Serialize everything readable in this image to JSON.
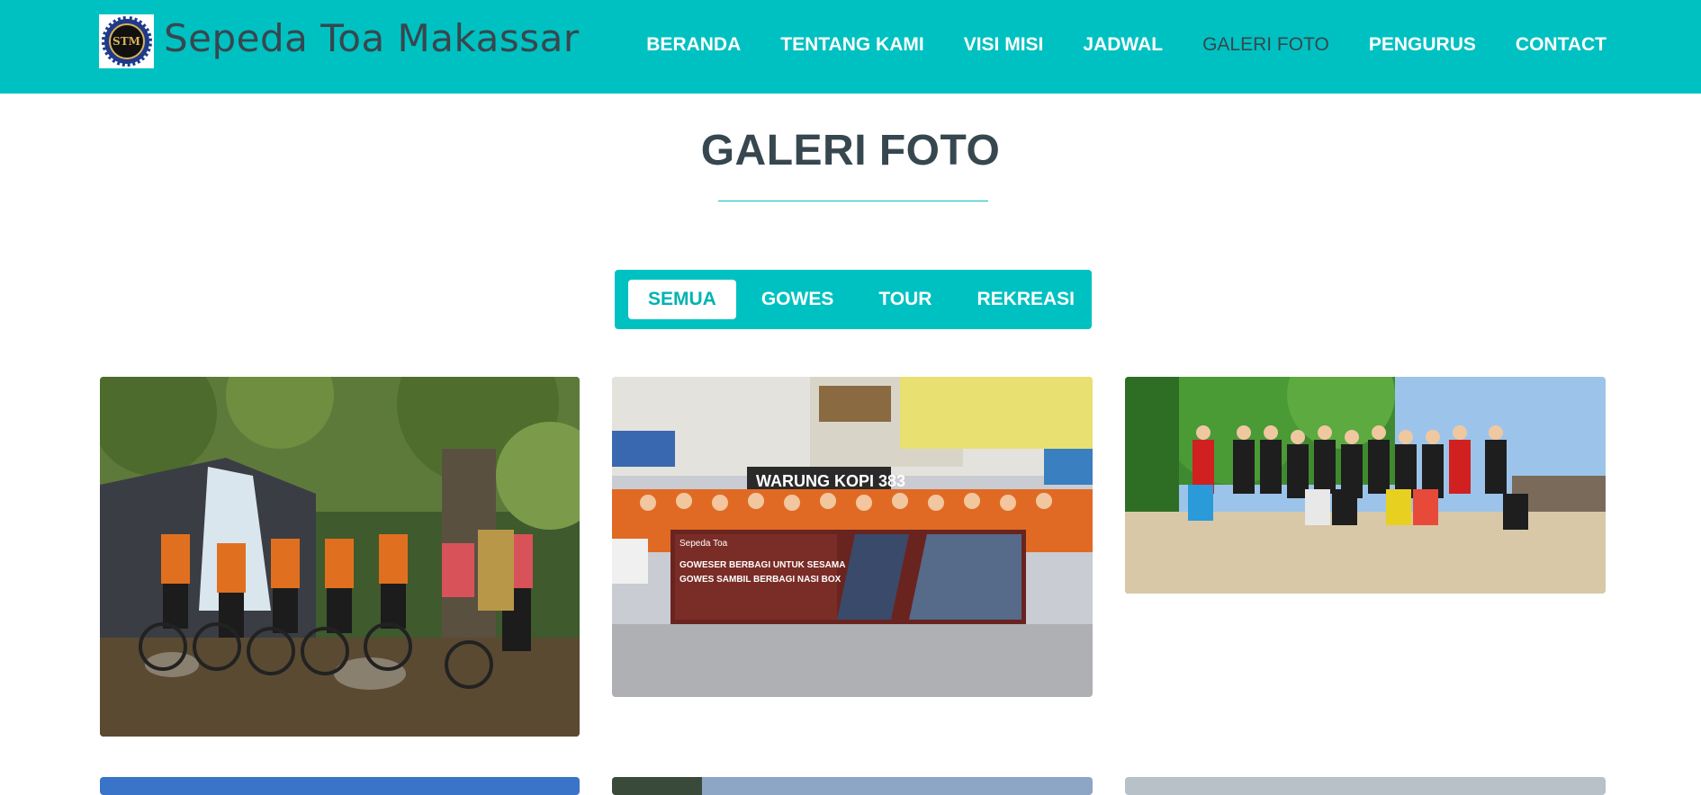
{
  "header": {
    "logo_text": "STM",
    "site_title": "Sepeda Toa Makassar",
    "nav": [
      {
        "label": "BERANDA",
        "active": false
      },
      {
        "label": "TENTANG KAMI",
        "active": false
      },
      {
        "label": "VISI MISI",
        "active": false
      },
      {
        "label": "JADWAL",
        "active": false
      },
      {
        "label": "GALERI FOTO",
        "active": true
      },
      {
        "label": "PENGURUS",
        "active": false
      },
      {
        "label": "CONTACT",
        "active": false
      }
    ]
  },
  "main": {
    "title": "GALERI FOTO",
    "filters": [
      {
        "label": "SEMUA",
        "active": true
      },
      {
        "label": "GOWES",
        "active": false
      },
      {
        "label": "TOUR",
        "active": false
      },
      {
        "label": "REKREASI",
        "active": false
      }
    ],
    "photos": [
      {
        "subject": "cyclists at waterfall"
      },
      {
        "subject": "group with banner at warung kopi"
      },
      {
        "subject": "group on beach"
      },
      {
        "subject": "photo"
      },
      {
        "subject": "photo"
      },
      {
        "subject": "photo"
      }
    ],
    "banner_text": {
      "brand": "Sepeda Toa",
      "line1": "GOWESER BERBAGI UNTUK SESAMA",
      "line2": "GOWES SAMBIL BERBAGI NASI BOX",
      "shop_sign": "WARUNG KOPI 383"
    }
  },
  "colors": {
    "accent": "#00c1c1",
    "text_dark": "#37474f",
    "white": "#ffffff"
  }
}
